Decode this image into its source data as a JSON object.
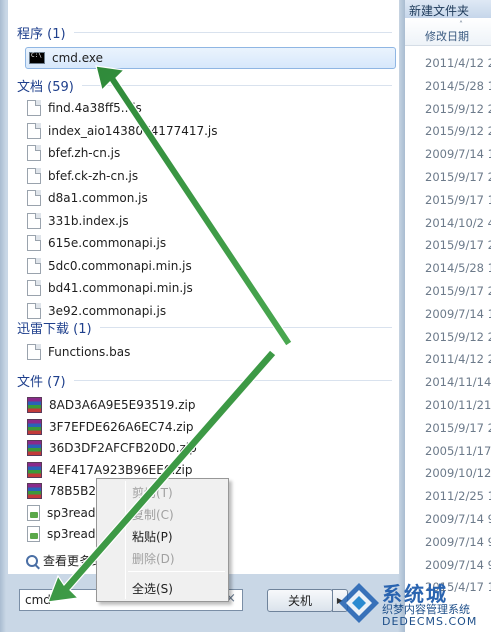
{
  "background_window": {
    "title": "新建文件夹",
    "column_header": "修改日期",
    "dates": [
      "2011/4/12 2",
      "2014/5/28 1",
      "2015/9/12 2",
      "2015/9/12 2",
      "2009/7/14 1",
      "2015/9/17 2",
      "2015/9/17 1",
      "2014/10/2 4",
      "2015/9/17 2",
      "2014/5/28 1",
      "2015/9/17 2",
      "2009/7/14 1",
      "2015/9/12 2",
      "2011/4/12 2",
      "2014/11/14",
      "2010/11/21",
      "2015/9/17 2",
      "2005/11/17",
      "2009/10/12",
      "2011/2/25 1",
      "2009/7/14 9",
      "2009/7/14 9",
      "2009/7/14 9",
      "2015/4/17 1"
    ]
  },
  "groups": [
    {
      "header": "程序 (1)",
      "items": [
        {
          "label": "cmd.exe",
          "icon": "cmd-icon"
        }
      ]
    },
    {
      "header": "文档 (59)",
      "items": [
        {
          "label": "find.4a38ff5...js",
          "icon": "document-icon"
        },
        {
          "label": "index_aio1438074177417.js",
          "icon": "document-icon"
        },
        {
          "label": "bfef.zh-cn.js",
          "icon": "document-icon"
        },
        {
          "label": "bfef.ck-zh-cn.js",
          "icon": "document-icon"
        },
        {
          "label": "d8a1.common.js",
          "icon": "document-icon"
        },
        {
          "label": "331b.index.js",
          "icon": "document-icon"
        },
        {
          "label": "615e.commonapi.js",
          "icon": "document-icon"
        },
        {
          "label": "5dc0.commonapi.min.js",
          "icon": "document-icon"
        },
        {
          "label": "bd41.commonapi.min.js",
          "icon": "document-icon"
        },
        {
          "label": "3e92.commonapi.js",
          "icon": "document-icon"
        }
      ]
    },
    {
      "header": "迅雷下载 (1)",
      "items": [
        {
          "label": "Functions.bas",
          "icon": "document-icon"
        }
      ]
    },
    {
      "header": "文件 (7)",
      "items": [
        {
          "label": "8AD3A6A9E5E93519.zip",
          "icon": "zip-icon"
        },
        {
          "label": "3F7EFDE626A6EC74.zip",
          "icon": "zip-icon"
        },
        {
          "label": "36D3DF2AFCFB20D0.zip",
          "icon": "zip-icon"
        },
        {
          "label": "4EF417A923B96EE6.zip",
          "icon": "zip-icon"
        },
        {
          "label": "78B5B26",
          "icon": "zip-icon"
        },
        {
          "label": "sp3read",
          "icon": "text-icon"
        },
        {
          "label": "sp3read",
          "icon": "text-icon"
        }
      ]
    }
  ],
  "see_more": "查看更多结",
  "search": {
    "value": "cmd",
    "clear": "×"
  },
  "shutdown": {
    "label": "关机",
    "arrow": "▶"
  },
  "context_menu": {
    "cut": "剪切(T)",
    "copy": "复制(C)",
    "paste": "粘贴(P)",
    "delete": "删除(D)",
    "select_all": "全选(S)"
  },
  "watermark": {
    "brand": "系统城",
    "subtitle": "织梦内容管理系统",
    "domain": "DEDECMS.COM"
  },
  "colors": {
    "arrow": "#2f8a3a",
    "accent": "#1e3f8c",
    "selection_border": "#8fb6e3"
  }
}
